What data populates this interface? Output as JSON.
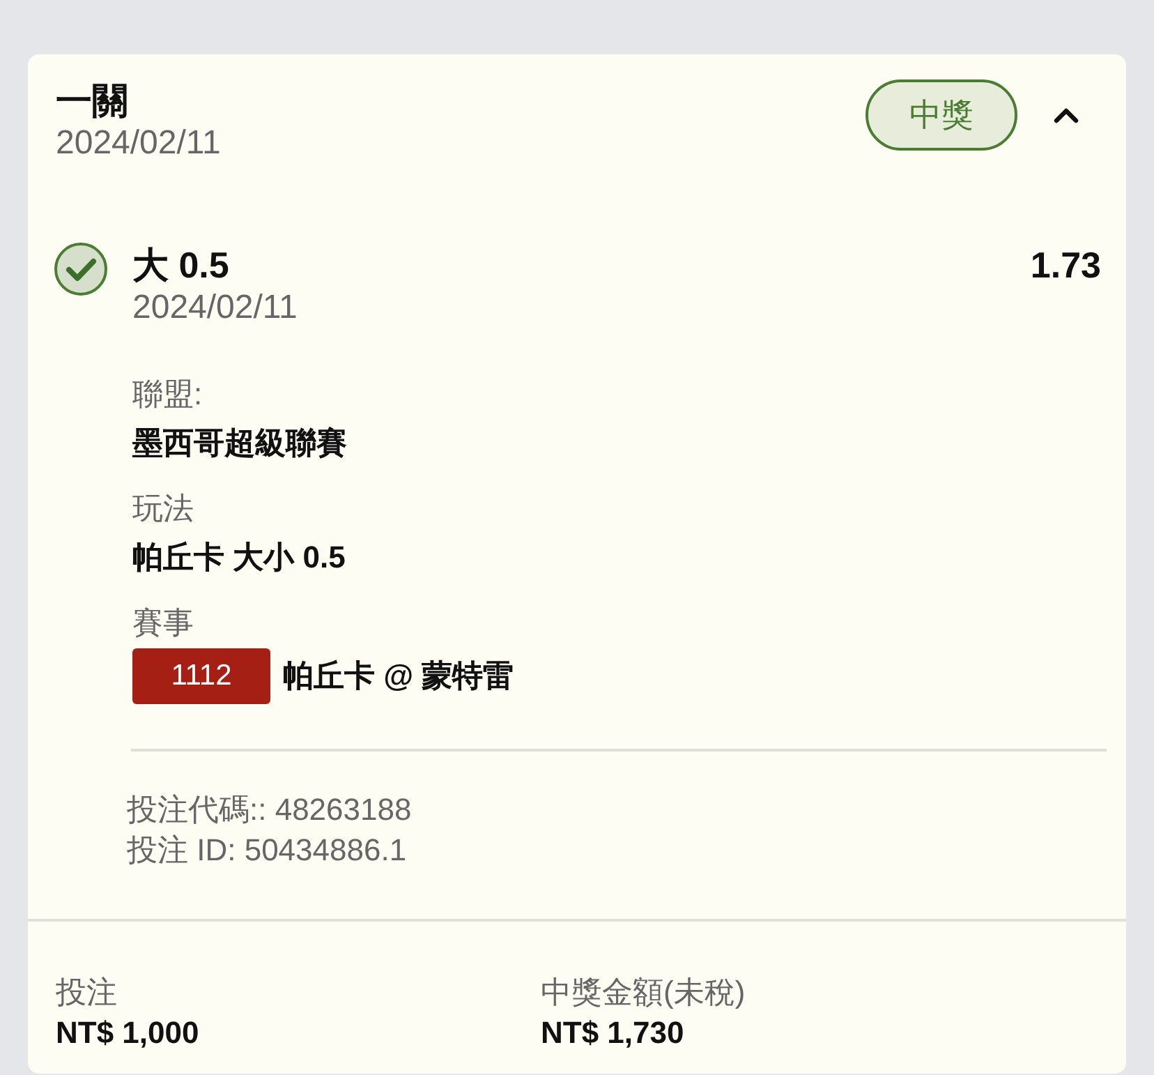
{
  "bet": {
    "title": "一關",
    "date": "2024/02/11",
    "status": "中獎",
    "expanded": true
  },
  "selection": {
    "won": true,
    "pick": "大 0.5",
    "odds": "1.73",
    "date": "2024/02/11",
    "details": [
      {
        "kind": "text",
        "label": "聯盟:",
        "value": "墨西哥超級聯賽"
      },
      {
        "kind": "text",
        "label": "玩法",
        "value": "帕丘卡 大小 0.5"
      },
      {
        "kind": "match",
        "label": "賽事",
        "match_number": "1112",
        "value": "帕丘卡 @ 蒙特雷"
      }
    ]
  },
  "references": [
    "投注代碼:: 48263188",
    "投注 ID: 50434886.1"
  ],
  "summary": [
    {
      "label": "投注",
      "value": "NT$ 1,000"
    },
    {
      "label": "中獎金額(未稅)",
      "value": "NT$ 1,730"
    }
  ]
}
